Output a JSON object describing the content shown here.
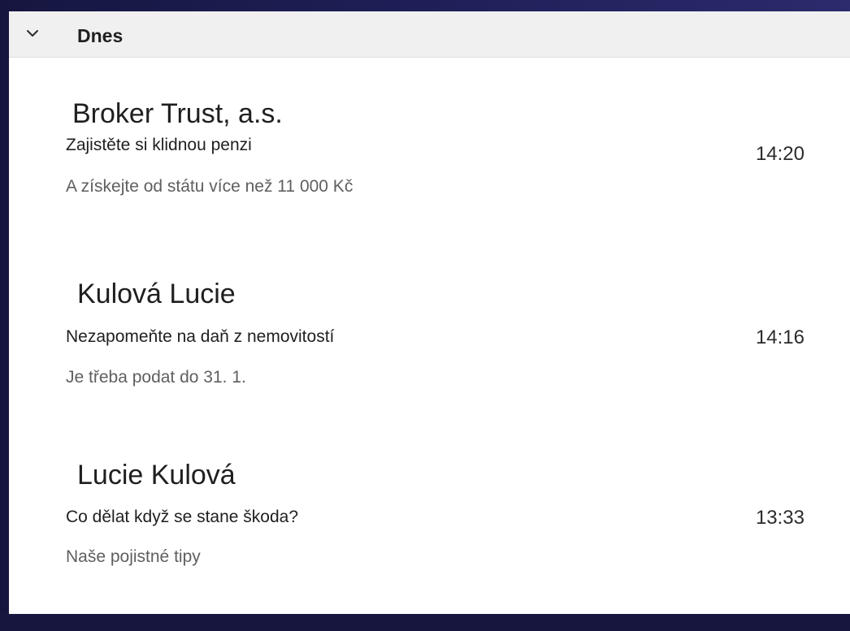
{
  "group": {
    "title": "Dnes",
    "chevron_icon": "chevron-down-icon"
  },
  "messages": [
    {
      "sender": "Broker Trust, a.s.",
      "subject": "Zajistěte si klidnou penzi",
      "preview": "A získejte od státu více než 11 000 Kč",
      "time": "14:20"
    },
    {
      "sender": "Kulová Lucie",
      "subject": "Nezapomeňte na daň z nemovitostí",
      "preview": "Je třeba podat do 31. 1.",
      "time": "14:16"
    },
    {
      "sender": "Lucie Kulová",
      "subject": "Co dělat když se stane škoda?",
      "preview": "Naše pojistné tipy",
      "time": "13:33"
    }
  ]
}
